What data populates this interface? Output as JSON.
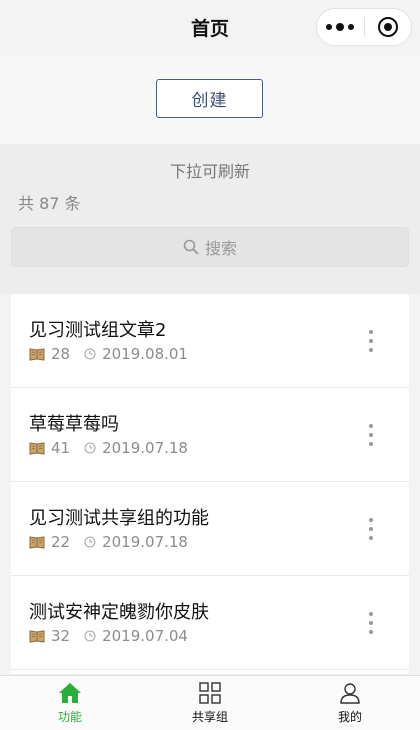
{
  "nav": {
    "title": "首页"
  },
  "create_button": "创建",
  "pull_refresh_text": "下拉可刷新",
  "count_text": "共 87 条",
  "search": {
    "placeholder": "搜索"
  },
  "items": [
    {
      "title": "见习测试组文章2",
      "count": "28",
      "date": "2019.08.01"
    },
    {
      "title": "草莓草莓吗",
      "count": "41",
      "date": "2019.07.18"
    },
    {
      "title": "见习测试共享组的功能",
      "count": "22",
      "date": "2019.07.18"
    },
    {
      "title": "测试安神定魄勠你皮肤",
      "count": "32",
      "date": "2019.07.04"
    }
  ],
  "tabs": [
    {
      "label": "功能",
      "icon": "home-icon",
      "active": true
    },
    {
      "label": "共享组",
      "icon": "grid-icon",
      "active": false
    },
    {
      "label": "我的",
      "icon": "user-icon",
      "active": false
    }
  ],
  "colors": {
    "active_tab": "#2aae39",
    "button_border": "#4a5c7f"
  }
}
